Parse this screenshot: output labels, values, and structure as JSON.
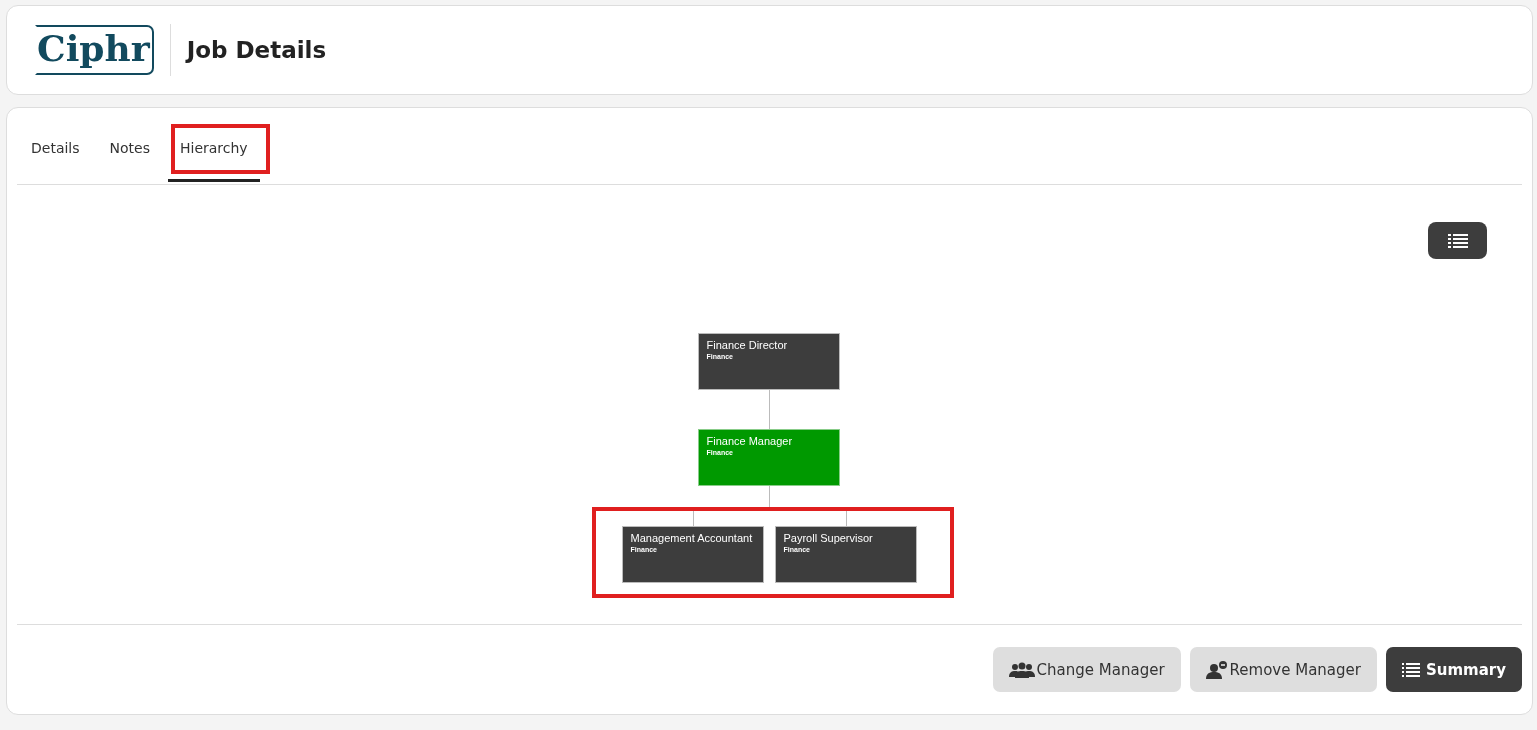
{
  "header": {
    "logo": "Ciphr",
    "title": "Job Details"
  },
  "tabs": [
    {
      "label": "Details",
      "selected": false
    },
    {
      "label": "Notes",
      "selected": false
    },
    {
      "label": "Hierarchy",
      "selected": true
    }
  ],
  "hierarchy": {
    "nodes": [
      {
        "title": "Finance Director",
        "department": "Finance",
        "selected": false,
        "children": [
          {
            "title": "Finance Manager",
            "department": "Finance",
            "selected": true,
            "children": [
              {
                "title": "Management Accountant",
                "department": "Finance",
                "selected": false
              },
              {
                "title": "Payroll Supervisor",
                "department": "Finance",
                "selected": false
              }
            ]
          }
        ]
      }
    ]
  },
  "buttons": [
    {
      "label": "Change Manager",
      "kind": "change"
    },
    {
      "label": "Remove Manager",
      "kind": "remove"
    },
    {
      "label": "Summary",
      "kind": "summary"
    }
  ]
}
